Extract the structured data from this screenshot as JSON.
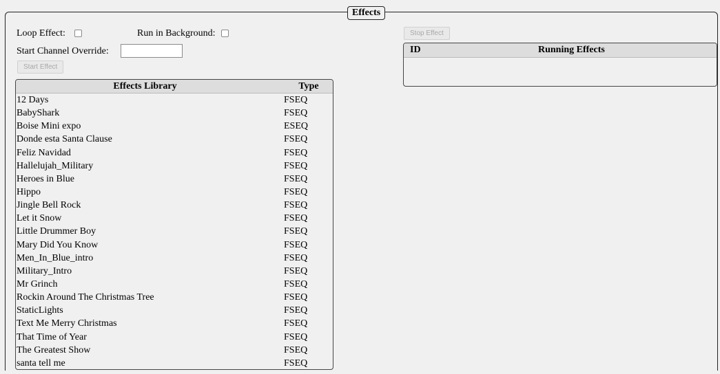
{
  "panel": {
    "legend": "Effects"
  },
  "controls": {
    "loop_label": "Loop Effect:",
    "background_label": "Run in Background:",
    "channel_label": "Start Channel Override:",
    "channel_value": "",
    "start_button": "Start Effect",
    "stop_button": "Stop Effect"
  },
  "library": {
    "headers": {
      "name": "Effects Library",
      "type": "Type"
    },
    "rows": [
      {
        "name": "12 Days",
        "type": "FSEQ"
      },
      {
        "name": "BabyShark",
        "type": "FSEQ"
      },
      {
        "name": "Boise Mini expo",
        "type": "ESEQ"
      },
      {
        "name": "Donde esta Santa Clause",
        "type": "FSEQ"
      },
      {
        "name": "Feliz Navidad",
        "type": "FSEQ"
      },
      {
        "name": "Hallelujah_Military",
        "type": "FSEQ"
      },
      {
        "name": "Heroes in Blue",
        "type": "FSEQ"
      },
      {
        "name": "Hippo",
        "type": "FSEQ"
      },
      {
        "name": "Jingle Bell Rock",
        "type": "FSEQ"
      },
      {
        "name": "Let it Snow",
        "type": "FSEQ"
      },
      {
        "name": "Little Drummer Boy",
        "type": "FSEQ"
      },
      {
        "name": "Mary Did You Know",
        "type": "FSEQ"
      },
      {
        "name": "Men_In_Blue_intro",
        "type": "FSEQ"
      },
      {
        "name": "Military_Intro",
        "type": "FSEQ"
      },
      {
        "name": "Mr Grinch",
        "type": "FSEQ"
      },
      {
        "name": "Rockin Around The Christmas Tree",
        "type": "FSEQ"
      },
      {
        "name": "StaticLights",
        "type": "FSEQ"
      },
      {
        "name": "Text Me Merry Christmas",
        "type": "FSEQ"
      },
      {
        "name": "That Time of Year",
        "type": "FSEQ"
      },
      {
        "name": "The Greatest Show",
        "type": "FSEQ"
      },
      {
        "name": "santa tell me",
        "type": "FSEQ"
      }
    ]
  },
  "running": {
    "headers": {
      "id": "ID",
      "effects": "Running Effects"
    },
    "rows": []
  }
}
